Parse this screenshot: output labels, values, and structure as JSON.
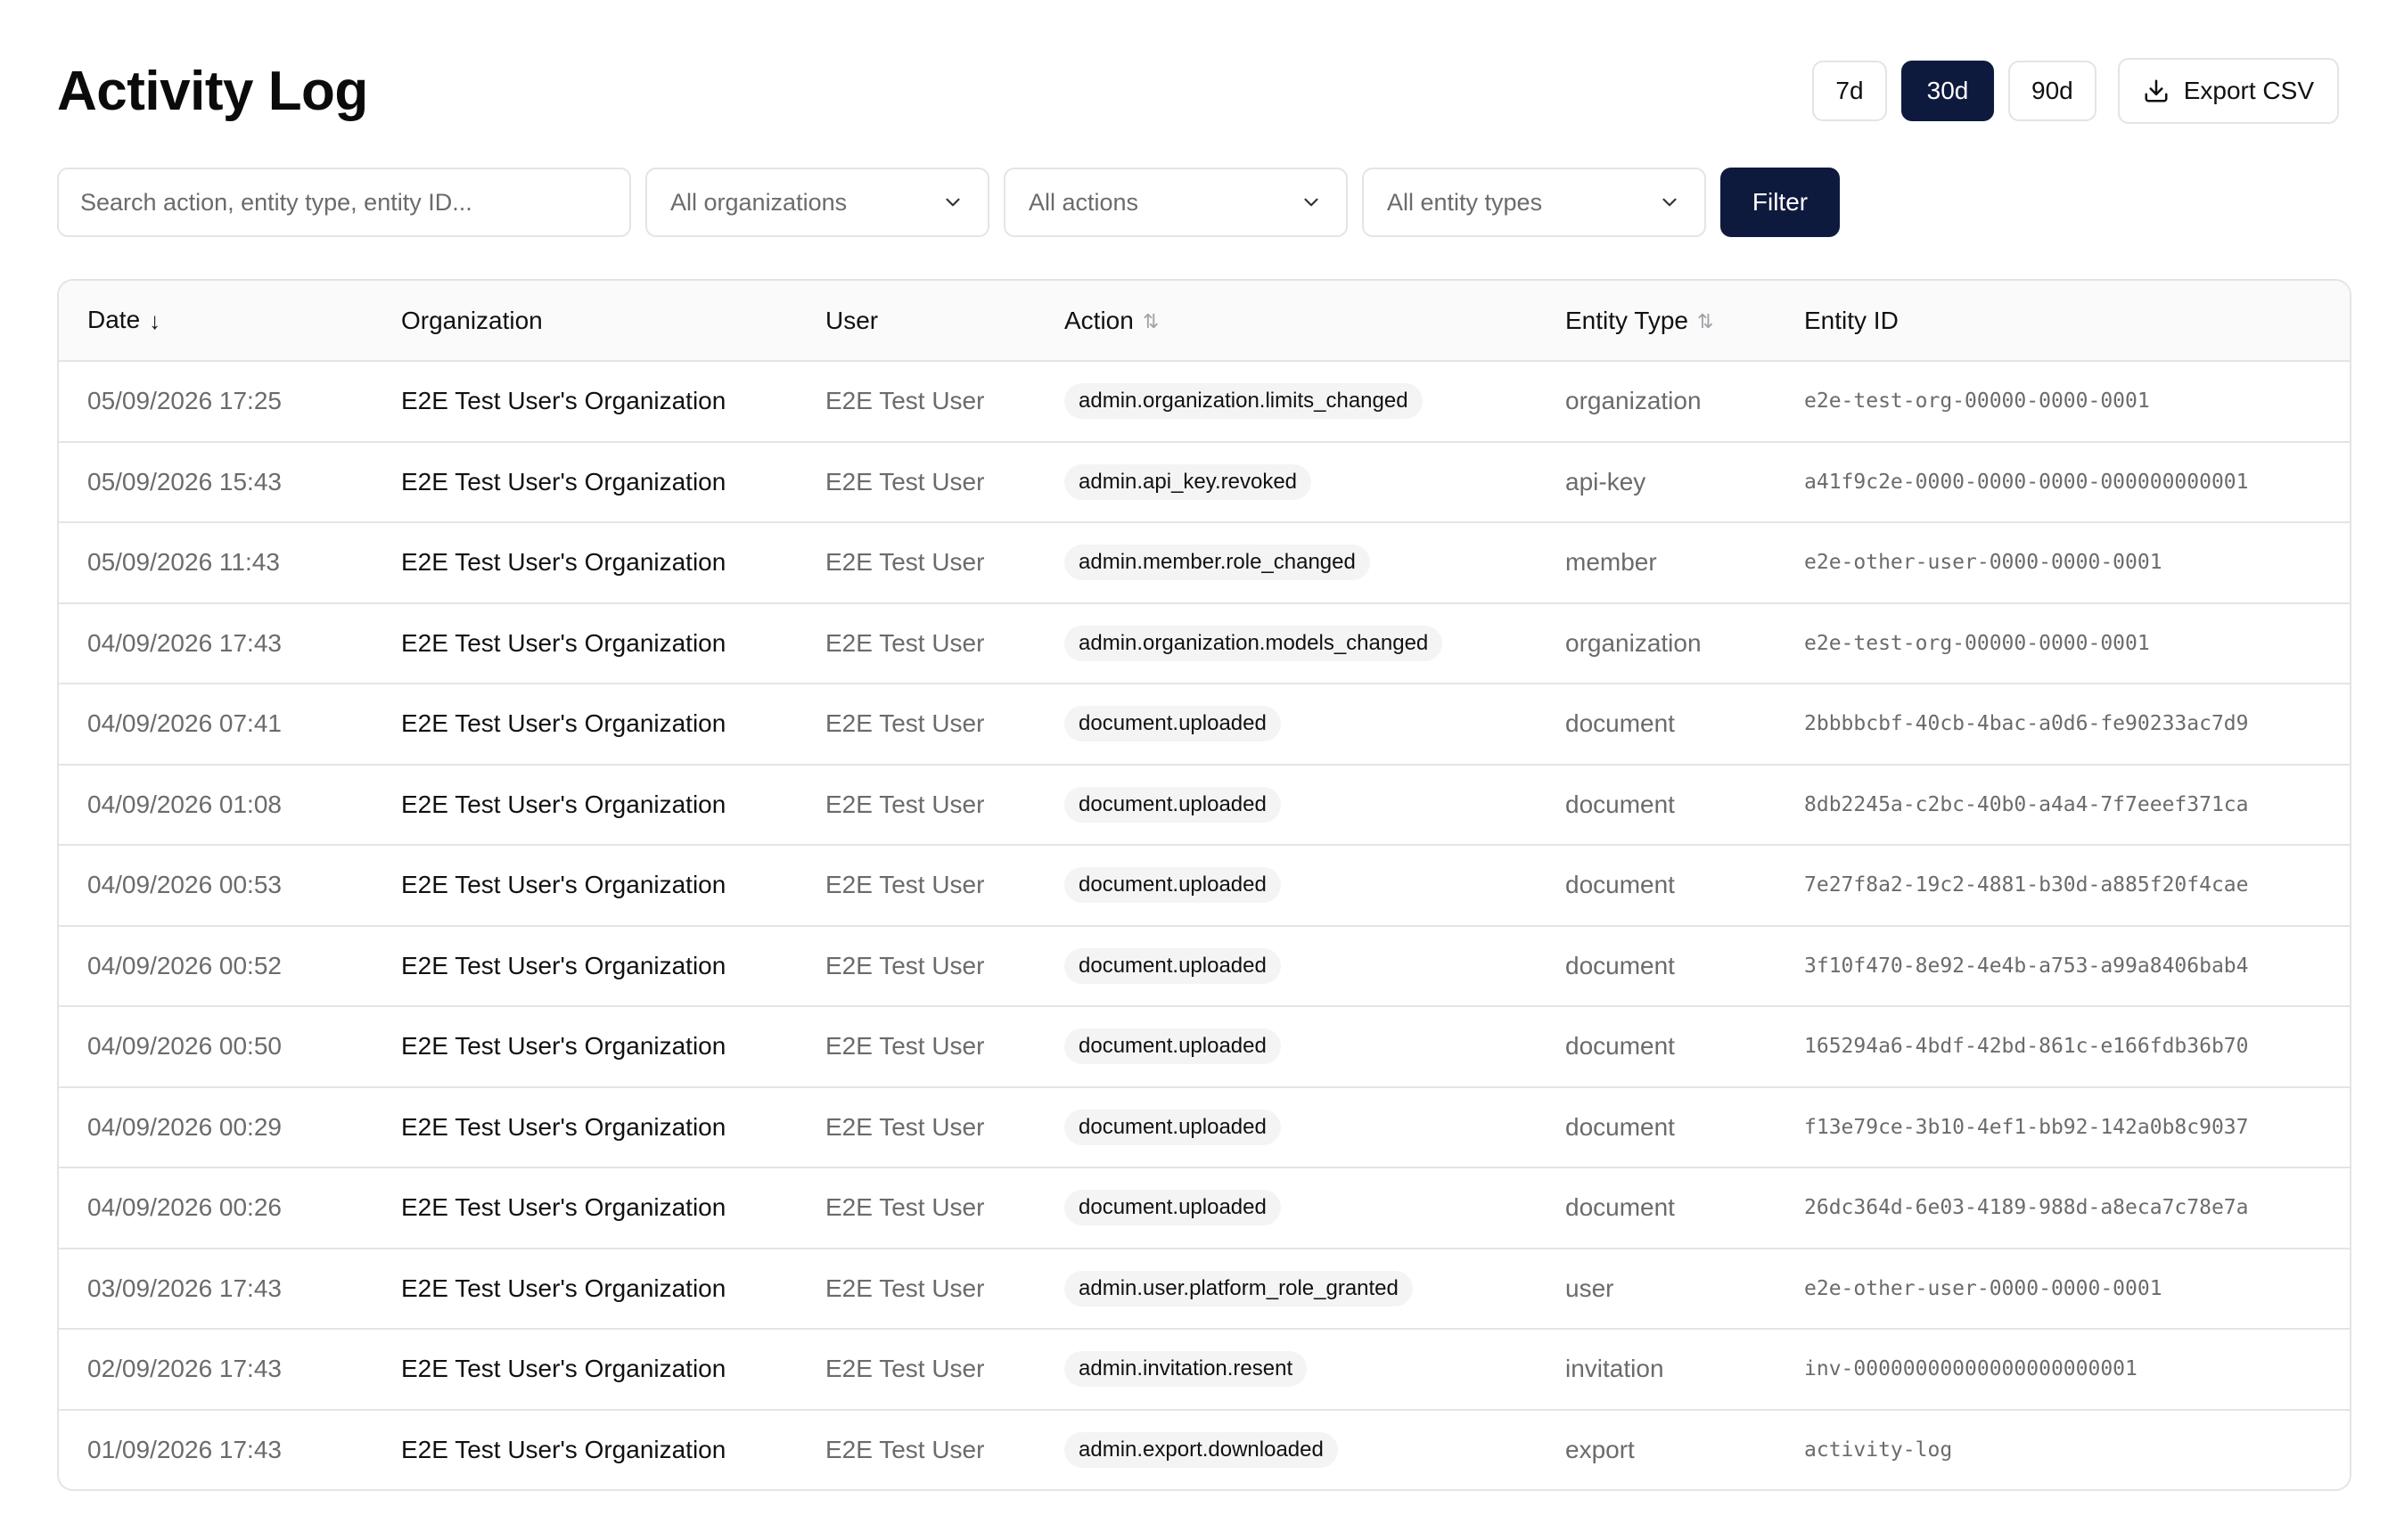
{
  "header": {
    "title": "Activity Log",
    "ranges": [
      {
        "label": "7d",
        "active": false
      },
      {
        "label": "30d",
        "active": true
      },
      {
        "label": "90d",
        "active": false
      }
    ],
    "export_label": "Export CSV",
    "export_icon": "download-icon"
  },
  "filters": {
    "search_placeholder": "Search action, entity type, entity ID...",
    "organization": "All organizations",
    "action": "All actions",
    "entity_type": "All entity types",
    "filter_label": "Filter"
  },
  "table": {
    "columns": [
      {
        "label": "Date",
        "sort": "desc"
      },
      {
        "label": "Organization",
        "sort": "none"
      },
      {
        "label": "User",
        "sort": "none"
      },
      {
        "label": "Action",
        "sort": "both"
      },
      {
        "label": "Entity Type",
        "sort": "both"
      },
      {
        "label": "Entity ID",
        "sort": "none"
      }
    ],
    "rows": [
      {
        "date": "05/09/2026 17:25",
        "org": "E2E Test User's Organization",
        "user": "E2E Test User",
        "action": "admin.organization.limits_changed",
        "etype": "organization",
        "eid": "e2e-test-org-00000-0000-0001"
      },
      {
        "date": "05/09/2026 15:43",
        "org": "E2E Test User's Organization",
        "user": "E2E Test User",
        "action": "admin.api_key.revoked",
        "etype": "api-key",
        "eid": "a41f9c2e-0000-0000-0000-000000000001"
      },
      {
        "date": "05/09/2026 11:43",
        "org": "E2E Test User's Organization",
        "user": "E2E Test User",
        "action": "admin.member.role_changed",
        "etype": "member",
        "eid": "e2e-other-user-0000-0000-0001"
      },
      {
        "date": "04/09/2026 17:43",
        "org": "E2E Test User's Organization",
        "user": "E2E Test User",
        "action": "admin.organization.models_changed",
        "etype": "organization",
        "eid": "e2e-test-org-00000-0000-0001"
      },
      {
        "date": "04/09/2026 07:41",
        "org": "E2E Test User's Organization",
        "user": "E2E Test User",
        "action": "document.uploaded",
        "etype": "document",
        "eid": "2bbbbcbf-40cb-4bac-a0d6-fe90233ac7d9"
      },
      {
        "date": "04/09/2026 01:08",
        "org": "E2E Test User's Organization",
        "user": "E2E Test User",
        "action": "document.uploaded",
        "etype": "document",
        "eid": "8db2245a-c2bc-40b0-a4a4-7f7eeef371ca"
      },
      {
        "date": "04/09/2026 00:53",
        "org": "E2E Test User's Organization",
        "user": "E2E Test User",
        "action": "document.uploaded",
        "etype": "document",
        "eid": "7e27f8a2-19c2-4881-b30d-a885f20f4cae"
      },
      {
        "date": "04/09/2026 00:52",
        "org": "E2E Test User's Organization",
        "user": "E2E Test User",
        "action": "document.uploaded",
        "etype": "document",
        "eid": "3f10f470-8e92-4e4b-a753-a99a8406bab4"
      },
      {
        "date": "04/09/2026 00:50",
        "org": "E2E Test User's Organization",
        "user": "E2E Test User",
        "action": "document.uploaded",
        "etype": "document",
        "eid": "165294a6-4bdf-42bd-861c-e166fdb36b70"
      },
      {
        "date": "04/09/2026 00:29",
        "org": "E2E Test User's Organization",
        "user": "E2E Test User",
        "action": "document.uploaded",
        "etype": "document",
        "eid": "f13e79ce-3b10-4ef1-bb92-142a0b8c9037"
      },
      {
        "date": "04/09/2026 00:26",
        "org": "E2E Test User's Organization",
        "user": "E2E Test User",
        "action": "document.uploaded",
        "etype": "document",
        "eid": "26dc364d-6e03-4189-988d-a8eca7c78e7a"
      },
      {
        "date": "03/09/2026 17:43",
        "org": "E2E Test User's Organization",
        "user": "E2E Test User",
        "action": "admin.user.platform_role_granted",
        "etype": "user",
        "eid": "e2e-other-user-0000-0000-0001"
      },
      {
        "date": "02/09/2026 17:43",
        "org": "E2E Test User's Organization",
        "user": "E2E Test User",
        "action": "admin.invitation.resent",
        "etype": "invitation",
        "eid": "inv-00000000000000000000001"
      },
      {
        "date": "01/09/2026 17:43",
        "org": "E2E Test User's Organization",
        "user": "E2E Test User",
        "action": "admin.export.downloaded",
        "etype": "export",
        "eid": "activity-log"
      }
    ]
  },
  "colors": {
    "primary": "#0e1a3d",
    "border": "#e4e4e7",
    "muted_text": "#6b6b6b",
    "badge_bg": "#f4f4f5"
  }
}
